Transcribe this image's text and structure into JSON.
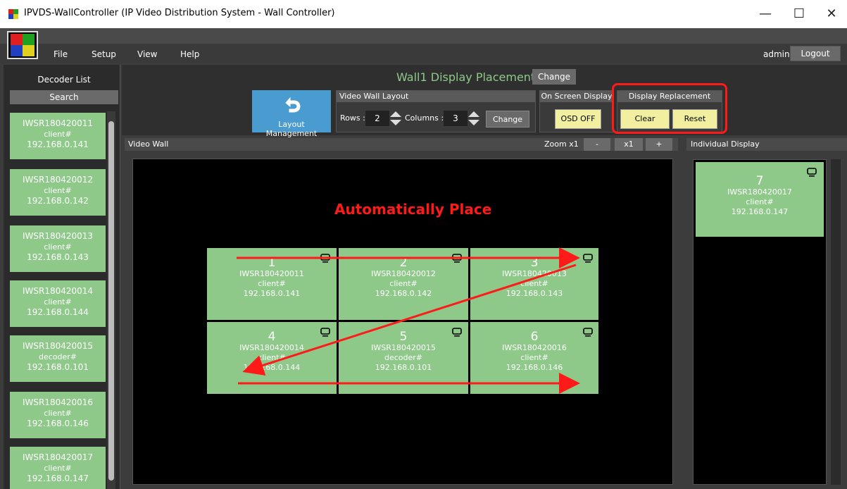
{
  "window": {
    "title": "IPVDS-WallController (IP Video Distribution System - Wall Controller)",
    "minimize_glyph": "—",
    "maximize_glyph": "☐",
    "close_glyph": "✕"
  },
  "menu": {
    "items": [
      "File",
      "Setup",
      "View",
      "Help"
    ],
    "user": "admin",
    "logout": "Logout"
  },
  "decoder_list": {
    "title": "Decoder List",
    "search": "Search",
    "items": [
      {
        "name": "IWSR180420011",
        "type": "client#",
        "ip": "192.168.0.141"
      },
      {
        "name": "IWSR180420012",
        "type": "client#",
        "ip": "192.168.0.142"
      },
      {
        "name": "IWSR180420013",
        "type": "client#",
        "ip": "192.168.0.143"
      },
      {
        "name": "IWSR180420014",
        "type": "client#",
        "ip": "192.168.0.144"
      },
      {
        "name": "IWSR180420015",
        "type": "decoder#",
        "ip": "192.168.0.101"
      },
      {
        "name": "IWSR180420016",
        "type": "client#",
        "ip": "192.168.0.146"
      },
      {
        "name": "IWSR180420017",
        "type": "client#",
        "ip": "192.168.0.147"
      }
    ]
  },
  "header": {
    "wall_title": "Wall1 Display Placement",
    "change": "Change",
    "layout_management": "Layout Management",
    "video_wall_layout": {
      "title": "Video Wall Layout",
      "rows_label": "Rows :",
      "rows": "2",
      "columns_label": "Columns :",
      "columns": "3",
      "change": "Change"
    },
    "osd": {
      "title": "On Screen Display",
      "button": "OSD OFF"
    },
    "display_replacement": {
      "title": "Display Replacement",
      "clear": "Clear",
      "reset": "Reset"
    }
  },
  "video_wall": {
    "label": "Video Wall",
    "zoom_label": "Zoom x1",
    "zoom_minus": "-",
    "zoom_x1": "x1",
    "zoom_plus": "+",
    "annotation": "Automatically Place",
    "cells": [
      {
        "num": "1",
        "name": "IWSR180420011",
        "type": "client#",
        "ip": "192.168.0.141"
      },
      {
        "num": "2",
        "name": "IWSR180420012",
        "type": "client#",
        "ip": "192.168.0.142"
      },
      {
        "num": "3",
        "name": "IWSR180420013",
        "type": "client#",
        "ip": "192.168.0.143"
      },
      {
        "num": "4",
        "name": "IWSR180420014",
        "type": "client#",
        "ip": "192.168.0.144"
      },
      {
        "num": "5",
        "name": "IWSR180420015",
        "type": "decoder#",
        "ip": "192.168.0.101"
      },
      {
        "num": "6",
        "name": "IWSR180420016",
        "type": "client#",
        "ip": "192.168.0.146"
      }
    ]
  },
  "individual_display": {
    "label": "Individual Display",
    "item": {
      "num": "7",
      "name": "IWSR180420017",
      "type": "client#",
      "ip": "192.168.0.147"
    }
  },
  "colors": {
    "tile_green": "#8ec98a",
    "accent_blue": "#4a9bd0",
    "annotation_red": "#ff1a1a",
    "button_yellow": "#f2f0a0"
  },
  "icons": [
    "app-logo-icon",
    "back-arrow-icon",
    "monitor-icon",
    "up-down-spinner-icon"
  ]
}
